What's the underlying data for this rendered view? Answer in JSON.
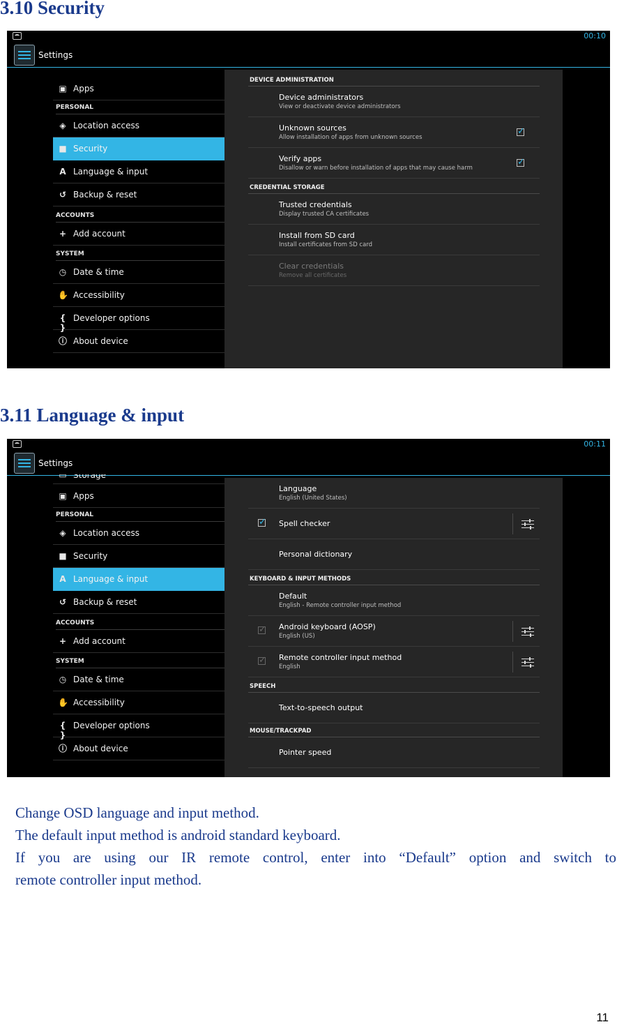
{
  "sections": [
    {
      "heading": "3.10 Security",
      "screenshot": {
        "clock": "00:10",
        "actionbar_title": "Settings",
        "left_items": [
          {
            "type": "item",
            "icon": "apps-icon",
            "glyph": "▣",
            "label": "Apps"
          },
          {
            "type": "header",
            "label": "PERSONAL"
          },
          {
            "type": "item",
            "icon": "location-icon",
            "glyph": "◈",
            "label": "Location access"
          },
          {
            "type": "item",
            "icon": "lock-icon",
            "glyph": "■",
            "label": "Security",
            "selected": true
          },
          {
            "type": "item",
            "icon": "keyboard-icon",
            "glyph": "A",
            "label": "Language & input"
          },
          {
            "type": "item",
            "icon": "backup-icon",
            "glyph": "↺",
            "label": "Backup & reset"
          },
          {
            "type": "header",
            "label": "ACCOUNTS"
          },
          {
            "type": "item",
            "icon": "add-icon",
            "glyph": "+",
            "label": "Add account"
          },
          {
            "type": "header",
            "label": "SYSTEM"
          },
          {
            "type": "item",
            "icon": "clock-icon",
            "glyph": "◷",
            "label": "Date & time"
          },
          {
            "type": "item",
            "icon": "hand-icon",
            "glyph": "✋",
            "label": "Accessibility"
          },
          {
            "type": "item",
            "icon": "braces-icon",
            "glyph": "{ }",
            "label": "Developer options"
          },
          {
            "type": "item",
            "icon": "info-icon",
            "glyph": "ⓘ",
            "label": "About device"
          }
        ],
        "right_items": [
          {
            "type": "header",
            "label": "DEVICE ADMINISTRATION"
          },
          {
            "type": "item",
            "title": "Device administrators",
            "summary": "View or deactivate device administrators"
          },
          {
            "type": "item",
            "title": "Unknown sources",
            "summary": "Allow installation of apps from unknown sources",
            "checkbox": "right",
            "checked": true
          },
          {
            "type": "item",
            "title": "Verify apps",
            "summary": "Disallow or warn before installation of apps that may cause harm",
            "checkbox": "right",
            "checked": true
          },
          {
            "type": "header",
            "label": "CREDENTIAL STORAGE"
          },
          {
            "type": "item",
            "title": "Trusted credentials",
            "summary": "Display trusted CA certificates"
          },
          {
            "type": "item",
            "title": "Install from SD card",
            "summary": "Install certificates from SD card"
          },
          {
            "type": "item",
            "title": "Clear credentials",
            "summary": "Remove all certificates",
            "disabled": true
          }
        ]
      }
    },
    {
      "heading": "3.11 Language & input",
      "screenshot": {
        "clock": "00:11",
        "actionbar_title": "Settings",
        "left_items": [
          {
            "type": "item",
            "icon": "storage-icon",
            "glyph": "▭",
            "label": "Storage",
            "partial": true
          },
          {
            "type": "item",
            "icon": "apps-icon",
            "glyph": "▣",
            "label": "Apps"
          },
          {
            "type": "header",
            "label": "PERSONAL"
          },
          {
            "type": "item",
            "icon": "location-icon",
            "glyph": "◈",
            "label": "Location access"
          },
          {
            "type": "item",
            "icon": "lock-icon",
            "glyph": "■",
            "label": "Security"
          },
          {
            "type": "item",
            "icon": "keyboard-icon",
            "glyph": "A",
            "label": "Language & input",
            "selected": true
          },
          {
            "type": "item",
            "icon": "backup-icon",
            "glyph": "↺",
            "label": "Backup & reset"
          },
          {
            "type": "header",
            "label": "ACCOUNTS"
          },
          {
            "type": "item",
            "icon": "add-icon",
            "glyph": "+",
            "label": "Add account"
          },
          {
            "type": "header",
            "label": "SYSTEM"
          },
          {
            "type": "item",
            "icon": "clock-icon",
            "glyph": "◷",
            "label": "Date & time"
          },
          {
            "type": "item",
            "icon": "hand-icon",
            "glyph": "✋",
            "label": "Accessibility"
          },
          {
            "type": "item",
            "icon": "braces-icon",
            "glyph": "{ }",
            "label": "Developer options"
          },
          {
            "type": "item",
            "icon": "info-icon",
            "glyph": "ⓘ",
            "label": "About device"
          }
        ],
        "right_items": [
          {
            "type": "item",
            "title": "Language",
            "summary": "English (United States)"
          },
          {
            "type": "item",
            "title": "Spell checker",
            "summary": "",
            "checkbox": "left",
            "checked": true,
            "settings": true
          },
          {
            "type": "item",
            "title": "Personal dictionary",
            "summary": ""
          },
          {
            "type": "header",
            "label": "KEYBOARD & INPUT METHODS"
          },
          {
            "type": "item",
            "title": "Default",
            "summary": "English - Remote controller input method"
          },
          {
            "type": "item",
            "title": "Android keyboard (AOSP)",
            "summary": "English (US)",
            "checkbox": "left",
            "checked": true,
            "dim": true,
            "settings": true
          },
          {
            "type": "item",
            "title": "Remote controller input method",
            "summary": "English",
            "checkbox": "left",
            "checked": true,
            "dim": true,
            "settings": true
          },
          {
            "type": "header",
            "label": "SPEECH"
          },
          {
            "type": "item",
            "title": "Text-to-speech output",
            "summary": ""
          },
          {
            "type": "header",
            "label": "MOUSE/TRACKPAD"
          },
          {
            "type": "item",
            "title": "Pointer speed",
            "summary": ""
          }
        ]
      }
    }
  ],
  "paragraph": {
    "line1": "Change OSD language and input method.",
    "line2": "The default input method is android standard keyboard.",
    "line3": "If you are using our IR remote control, enter into “Default” option and switch to",
    "line4": "remote controller input method."
  },
  "page_number": "11",
  "colors": {
    "accent": "#33b5e5",
    "heading": "#1a3a8c"
  }
}
